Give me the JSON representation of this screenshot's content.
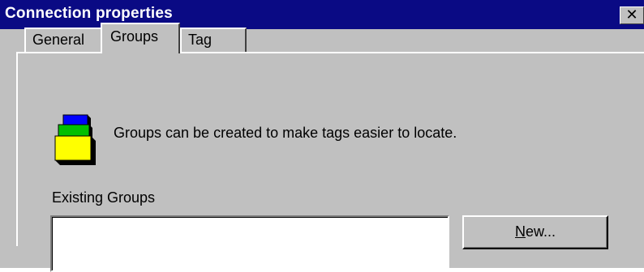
{
  "window": {
    "title": "Connection properties",
    "close_glyph": "✕"
  },
  "tabs": [
    {
      "label": "General",
      "active": false
    },
    {
      "label": "Groups",
      "active": true
    },
    {
      "label": "Tag",
      "active": false
    }
  ],
  "groups_panel": {
    "icon": "groups-stack-icon",
    "info_text": "Groups can be created to make tags easier to locate.",
    "existing_label": "Existing Groups",
    "new_button": {
      "mnemonic": "N",
      "rest": "ew..."
    }
  },
  "colors": {
    "titlebar": "#0a0a84",
    "face": "#c0c0c0"
  }
}
